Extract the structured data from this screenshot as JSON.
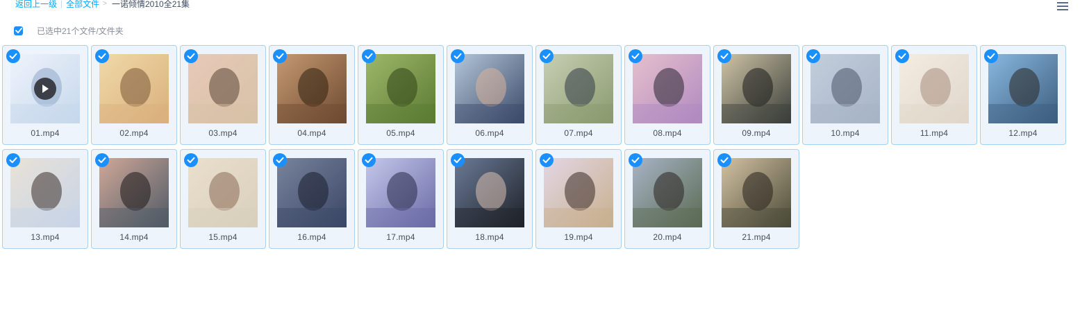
{
  "breadcrumb": {
    "back_label": "返回上一级",
    "root_label": "全部文件",
    "current_label": "一诺倾情2010全21集"
  },
  "selection": {
    "count_label": "已选中21个文件/文件夹"
  },
  "files": [
    {
      "name": "01.mp4",
      "colors": [
        "#c6d8ec",
        "#eef3fb",
        "#8fa8c8"
      ],
      "playing": true
    },
    {
      "name": "02.mp4",
      "colors": [
        "#d9b07c",
        "#f0d9a8",
        "#7a5838"
      ]
    },
    {
      "name": "03.mp4",
      "colors": [
        "#d6c2a6",
        "#e8c9b8",
        "#5a4636"
      ]
    },
    {
      "name": "04.mp4",
      "colors": [
        "#6e4a30",
        "#c59a72",
        "#30200f"
      ]
    },
    {
      "name": "05.mp4",
      "colors": [
        "#5b7a32",
        "#9db86a",
        "#2f4418"
      ]
    },
    {
      "name": "06.mp4",
      "colors": [
        "#3b4a6a",
        "#b4c7d8",
        "#d8b29a"
      ]
    },
    {
      "name": "07.mp4",
      "colors": [
        "#8a9a6e",
        "#c8cfb4",
        "#323a48"
      ]
    },
    {
      "name": "08.mp4",
      "colors": [
        "#b08ac0",
        "#e6c0cc",
        "#2a2430"
      ]
    },
    {
      "name": "09.mp4",
      "colors": [
        "#3a3e3a",
        "#cfc4a6",
        "#1a1c1c"
      ]
    },
    {
      "name": "10.mp4",
      "colors": [
        "#a6b4c6",
        "#c3cedc",
        "#4b5668"
      ]
    },
    {
      "name": "11.mp4",
      "colors": [
        "#e0d6ca",
        "#f4ece2",
        "#a88e80"
      ]
    },
    {
      "name": "12.mp4",
      "colors": [
        "#3c5e7e",
        "#8ab8e0",
        "#2a2622"
      ]
    },
    {
      "name": "13.mp4",
      "colors": [
        "#c8d4e6",
        "#e8e2d8",
        "#3a2e2a"
      ]
    },
    {
      "name": "14.mp4",
      "colors": [
        "#4e5a66",
        "#d0a898",
        "#1c1818"
      ]
    },
    {
      "name": "15.mp4",
      "colors": [
        "#d8cfbc",
        "#eadfcc",
        "#8a6c58"
      ]
    },
    {
      "name": "16.mp4",
      "colors": [
        "#3a4666",
        "#78849c",
        "#1a1e2e"
      ]
    },
    {
      "name": "17.mp4",
      "colors": [
        "#6a6aa6",
        "#c4c8ea",
        "#2a2a48"
      ]
    },
    {
      "name": "18.mp4",
      "colors": [
        "#1e2228",
        "#6a7a96",
        "#d8c0b0"
      ]
    },
    {
      "name": "19.mp4",
      "colors": [
        "#c8b08e",
        "#e2d6e4",
        "#3a2a26"
      ]
    },
    {
      "name": "20.mp4",
      "colors": [
        "#5a6a52",
        "#a8b4c6",
        "#2a2420"
      ]
    },
    {
      "name": "21.mp4",
      "colors": [
        "#4a4a38",
        "#d4c2a2",
        "#26201c"
      ]
    }
  ],
  "colors": {
    "accent": "#1a90ff",
    "link": "#06a7ff",
    "card_border": "#a6d2f2",
    "card_bg": "#eef4fb"
  }
}
